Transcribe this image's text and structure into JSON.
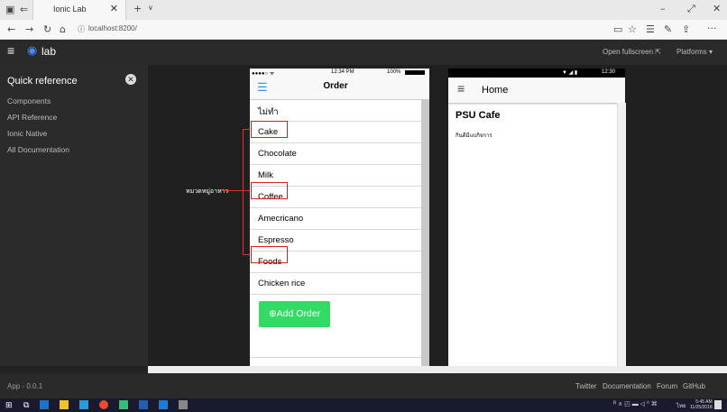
{
  "browser": {
    "tab_title": "Ionic Lab",
    "url": "localhost:8200/",
    "new_tab": "+",
    "tab_menu": "∨",
    "tab_close": "✕"
  },
  "lab": {
    "logo_text": "lab",
    "open_fullscreen": "Open fullscreen ⇱",
    "platforms": "Platforms ▾"
  },
  "sidebar": {
    "title": "Quick reference",
    "items": [
      "Components",
      "API Reference",
      "Ionic Native",
      "All Documentation"
    ]
  },
  "annotation": {
    "label": "หมวดหมู่อาหาร"
  },
  "ios": {
    "status_time": "12:34 PM",
    "status_carrier": "●●●●○ ᯤ",
    "status_battery": "100%",
    "title": "Order",
    "list": [
      "ไม่ทำ",
      "Cake",
      "Chocolate",
      "Milk",
      "Coffee",
      "Amecricano",
      "Espresso",
      "Foods",
      "Chicken rice"
    ],
    "add_button": "⊕Add Order"
  },
  "android": {
    "status_time": "12:30",
    "title": "Home",
    "heading": "PSU Cafe",
    "paragraph": "กินดีมีแบกิจการ"
  },
  "footer": {
    "version": "App - 0.0.1",
    "links": [
      "Twitter",
      "Documentation",
      "Forum",
      "GitHub"
    ]
  },
  "taskbar": {
    "time": "5:45 AM",
    "date": "11/25/2018",
    "language": "ไทย"
  }
}
